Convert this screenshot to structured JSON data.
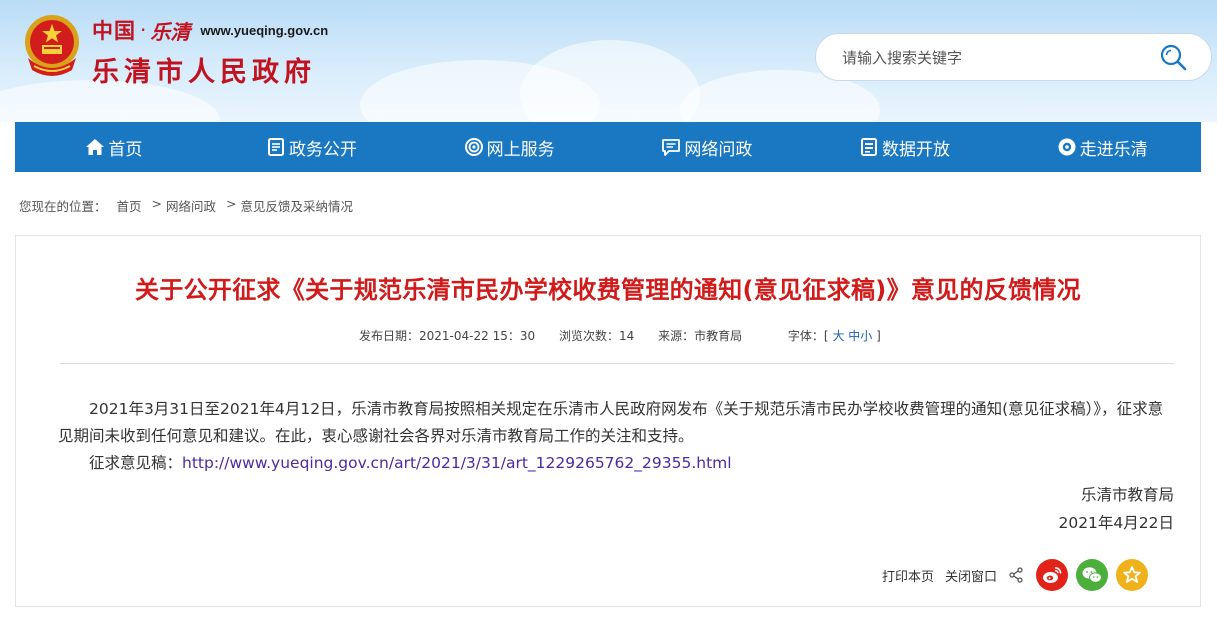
{
  "header": {
    "brand_cn": "中国",
    "brand_dot": "·",
    "brand_script": "乐清",
    "brand_url": "www.yueqing.gov.cn",
    "site_name": "乐清市人民政府",
    "emblem_icon": "national-emblem-icon"
  },
  "search": {
    "placeholder": "请输入搜索关键字",
    "icon": "search-icon"
  },
  "nav": {
    "items": [
      {
        "label": "首页",
        "icon": "home-icon"
      },
      {
        "label": "政务公开",
        "icon": "document-icon"
      },
      {
        "label": "网上服务",
        "icon": "service-icon"
      },
      {
        "label": "网络问政",
        "icon": "chat-icon"
      },
      {
        "label": "数据开放",
        "icon": "data-icon"
      },
      {
        "label": "走进乐清",
        "icon": "eye-icon"
      }
    ],
    "color": "#1a78c2"
  },
  "breadcrumb": {
    "prefix": "您现在的位置：",
    "items": [
      "首页",
      "网络问政",
      "意见反馈及采纳情况"
    ],
    "separator": ">"
  },
  "article": {
    "title": "关于公开征求《关于规范乐清市民办学校收费管理的通知(意见征求稿)》意见的反馈情况",
    "meta": {
      "publish_label": "发布日期：",
      "publish_date": "2021-04-22 15：30",
      "views_label": "浏览次数：",
      "views": "14",
      "source_label": "来源：",
      "source": "市教育局",
      "font_label": "字体：[",
      "font_large": "大",
      "font_medium": "中",
      "font_small": "小",
      "font_end": "]"
    },
    "paragraph": "2021年3月31日至2021年4月12日，乐清市教育局按照相关规定在乐清市人民政府网发布《关于规范乐清市民办学校收费管理的通知(意见征求稿）》，征求意见期间未收到任何意见和建议。在此，衷心感谢社会各界对乐清市教育局工作的关注和支持。",
    "link_label": "征求意见稿：",
    "link_url": "http://www.yueqing.gov.cn/art/2021/3/31/art_1229265762_29355.html",
    "sign_org": "乐清市教育局",
    "sign_date": "2021年4月22日",
    "title_color": "#d11a1a"
  },
  "tools": {
    "print": "打印本页",
    "close": "关闭窗口",
    "share_icon": "share-icon",
    "buttons": [
      {
        "icon": "weibo-icon",
        "color": "#e2231a"
      },
      {
        "icon": "wechat-icon",
        "color": "#4caf3c"
      },
      {
        "icon": "favorite-star-icon",
        "color": "#f0b21b"
      }
    ]
  }
}
